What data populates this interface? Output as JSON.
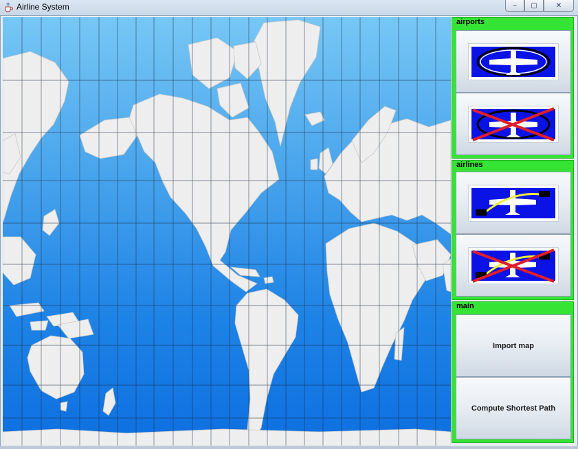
{
  "window": {
    "title": "Airline System",
    "controls": {
      "minimize": "‒",
      "maximize": "▢",
      "close": "✕"
    }
  },
  "map": {
    "ocean_top_color": "#77c7f5",
    "ocean_bottom_color": "#0e6fe0",
    "land_color": "#eeeeee",
    "grid_color": "#1a2a40"
  },
  "panel": {
    "accent_color": "#36e436",
    "groups": [
      {
        "label": "airports",
        "buttons": [
          {
            "icon": "add-airport-icon"
          },
          {
            "icon": "remove-airport-icon"
          }
        ]
      },
      {
        "label": "airlines",
        "buttons": [
          {
            "icon": "add-airline-icon"
          },
          {
            "icon": "remove-airline-icon"
          }
        ]
      },
      {
        "label": "main",
        "buttons": [
          {
            "text": "Import map"
          },
          {
            "text": "Compute Shortest Path"
          }
        ]
      }
    ]
  }
}
